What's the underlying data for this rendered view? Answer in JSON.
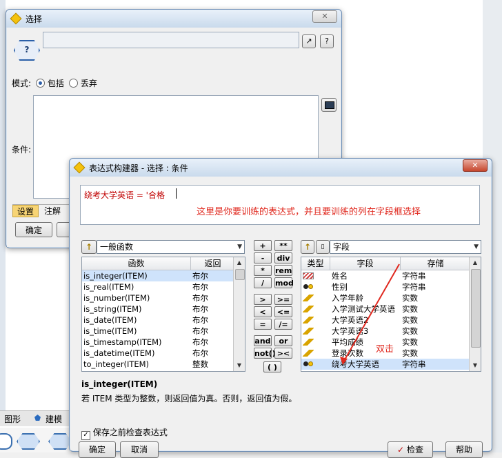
{
  "background": {
    "bottom_tabs": [
      "图形",
      "建模"
    ]
  },
  "select_dialog": {
    "title": "选择",
    "mode_label": "模式:",
    "mode_options": [
      {
        "label": "包括",
        "selected": true
      },
      {
        "label": "丢弃",
        "selected": false
      }
    ],
    "condition_label": "条件:",
    "tabs": [
      "设置",
      "注解"
    ],
    "ok_label": "确定"
  },
  "builder": {
    "title": "表达式构建器 - 选择 : 条件",
    "expression": "绕考大学英语 = '合格",
    "annotation_top": "这里是你要训练的表达式，并且要训练的列在字段框选择",
    "annotation_arrow": "双击",
    "function_category": "一般函数",
    "function_columns": [
      "函数",
      "返回"
    ],
    "functions": [
      {
        "name": "is_integer(ITEM)",
        "ret": "布尔",
        "selected": true
      },
      {
        "name": "is_real(ITEM)",
        "ret": "布尔"
      },
      {
        "name": "is_number(ITEM)",
        "ret": "布尔"
      },
      {
        "name": "is_string(ITEM)",
        "ret": "布尔"
      },
      {
        "name": "is_date(ITEM)",
        "ret": "布尔"
      },
      {
        "name": "is_time(ITEM)",
        "ret": "布尔"
      },
      {
        "name": "is_timestamp(ITEM)",
        "ret": "布尔"
      },
      {
        "name": "is_datetime(ITEM)",
        "ret": "布尔"
      },
      {
        "name": "to_integer(ITEM)",
        "ret": "整数"
      }
    ],
    "operators": [
      [
        "+",
        "**"
      ],
      [
        "-",
        "div"
      ],
      [
        "*",
        "rem"
      ],
      [
        "/",
        "mod"
      ],
      [
        ">",
        ">="
      ],
      [
        "<",
        "<="
      ],
      [
        "=",
        "/="
      ],
      [
        "and",
        "or"
      ],
      [
        "not()",
        "><"
      ],
      [
        "( )"
      ]
    ],
    "field_category": "字段",
    "field_columns": [
      "类型",
      "字段",
      "存储"
    ],
    "fields": [
      {
        "icon": "string-icon",
        "name": "姓名",
        "storage": "字符串"
      },
      {
        "icon": "flag-icon",
        "name": "性别",
        "storage": "字符串"
      },
      {
        "icon": "ruler-icon",
        "name": "入学年龄",
        "storage": "实数"
      },
      {
        "icon": "ruler-icon",
        "name": "入学测试大学英语",
        "storage": "实数"
      },
      {
        "icon": "ruler-icon",
        "name": "大学英语2",
        "storage": "实数"
      },
      {
        "icon": "ruler-icon",
        "name": "大学英语3",
        "storage": "实数"
      },
      {
        "icon": "ruler-icon",
        "name": "平均成绩",
        "storage": "实数"
      },
      {
        "icon": "ruler-icon",
        "name": "登录次数",
        "storage": "实数"
      },
      {
        "icon": "flag-icon",
        "name": "绕考大学英语",
        "storage": "字符串",
        "selected": true
      }
    ],
    "desc_title": "is_integer(ITEM)",
    "desc_text": "若 ITEM 类型为整数，则返回值为真。否则，返回值为假。",
    "check_before_save": "保存之前检查表达式",
    "ok_label": "确定",
    "cancel_label": "取消",
    "check_label": "检查",
    "help_label": "帮助",
    "colors": {
      "annotation": "#e0281e",
      "expression": "#c00000"
    }
  }
}
